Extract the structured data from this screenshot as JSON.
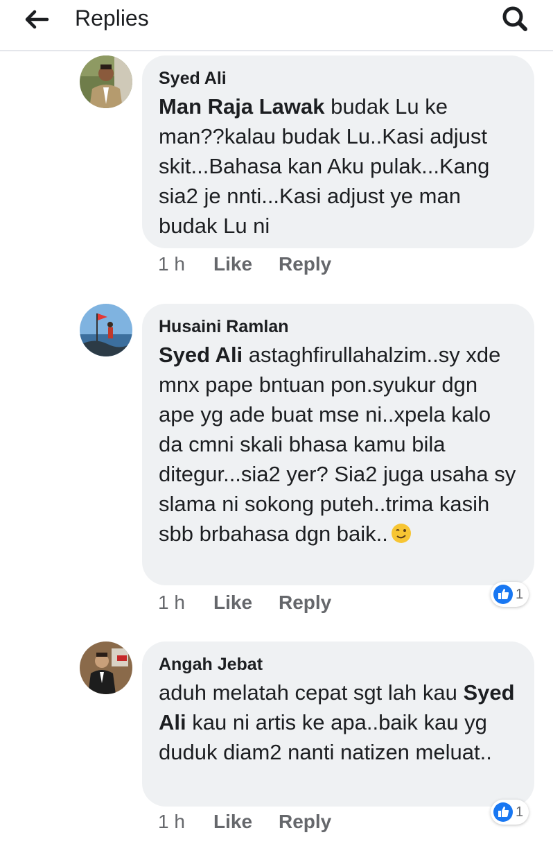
{
  "header": {
    "back_icon": "arrow-left-icon",
    "title": "Replies",
    "search_icon": "search-icon"
  },
  "comments": [
    {
      "author": "Syed Ali",
      "mention": "Man Raja Lawak",
      "text": "budak Lu ke man??kalau budak Lu..Kasi adjust skit...Bahasa kan Aku pulak...Kang sia2 je nnti...Kasi adjust ye man budak Lu ni",
      "time": "1 h",
      "like_label": "Like",
      "reply_label": "Reply"
    },
    {
      "author": "Husaini Ramlan",
      "mention": "Syed Ali",
      "text": "astaghfirullahalzim..sy xde mnx pape bntuan pon.syukur dgn ape yg ade buat mse ni..xpela kalo da cmni skali bhasa kamu bila ditegur...sia2 yer? Sia2 juga usaha sy slama ni sokong puteh..trima kasih sbb brbahasa dgn baik..",
      "emoji": "winking-face-emoji",
      "time": "1 h",
      "like_label": "Like",
      "reply_label": "Reply",
      "reaction": {
        "icon": "like-reaction-icon",
        "count": "1",
        "color": "#1877f2"
      }
    },
    {
      "author": "Angah Jebat",
      "text_before": "aduh melatah cepat sgt lah kau",
      "mention": "Syed Ali",
      "text": "kau ni artis ke apa..baik kau yg duduk diam2 nanti natizen meluat..",
      "time": "1 h",
      "like_label": "Like",
      "reply_label": "Reply",
      "reaction": {
        "icon": "like-reaction-icon",
        "count": "1",
        "color": "#1877f2"
      }
    }
  ]
}
